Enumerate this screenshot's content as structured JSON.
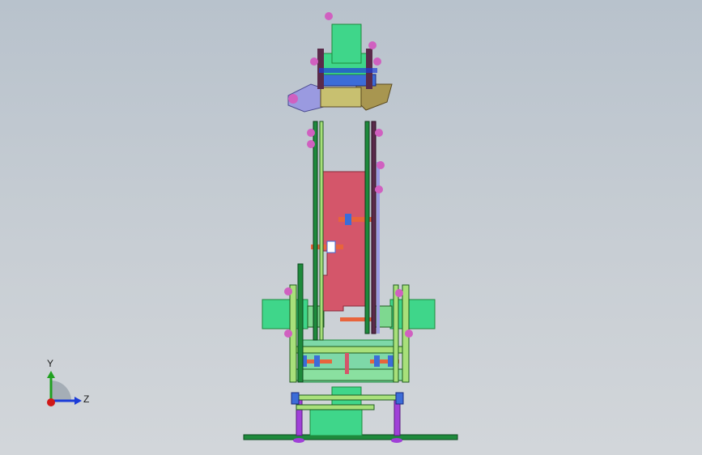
{
  "viewport": {
    "background_top": "#b8c2cc",
    "background_bottom": "#d2d6da"
  },
  "triad": {
    "y_label": "Y",
    "z_label": "Z",
    "y_color": "#20a020",
    "z_color": "#1c3cd8",
    "x_color": "#d01818"
  },
  "model": {
    "palette": {
      "green": "#3fd68a",
      "dark_green": "#1e8a3c",
      "red_plate": "#d4566a",
      "orange_bolt": "#e8643c",
      "blue_nut": "#3c6cd8",
      "purple": "#a040d8",
      "olive": "#a89650",
      "lavender": "#9a9ae0",
      "magenta": "#d060c0",
      "pale_green": "#7ed890"
    }
  }
}
